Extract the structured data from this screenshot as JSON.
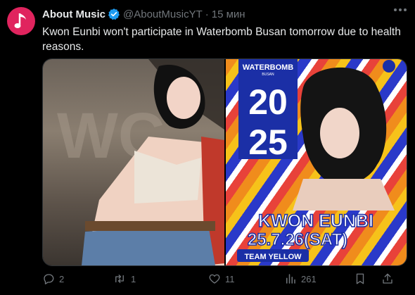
{
  "author": {
    "name": "About Music",
    "handle": "@AboutMusicYT",
    "time": "15 мин"
  },
  "tweet": {
    "text": "Kwon Eunbi won't participate in Waterbomb Busan tomorrow due to health reasons."
  },
  "poster": {
    "event": "WATERBOMB",
    "city": "BUSAN",
    "year_top": "20",
    "year_bottom": "25",
    "artist": "KWON EUNBI",
    "date": "25.7.26(SAT)",
    "team": "TEAM YELLOW"
  },
  "stage_sign": "WC",
  "actions": {
    "replies": "2",
    "reposts": "1",
    "likes": "11",
    "views": "261"
  },
  "colors": {
    "verified": "#1d9bf0",
    "avatar": "#e0245e",
    "background": "#000000",
    "text": "#e7e9ea",
    "muted": "#71767b"
  }
}
